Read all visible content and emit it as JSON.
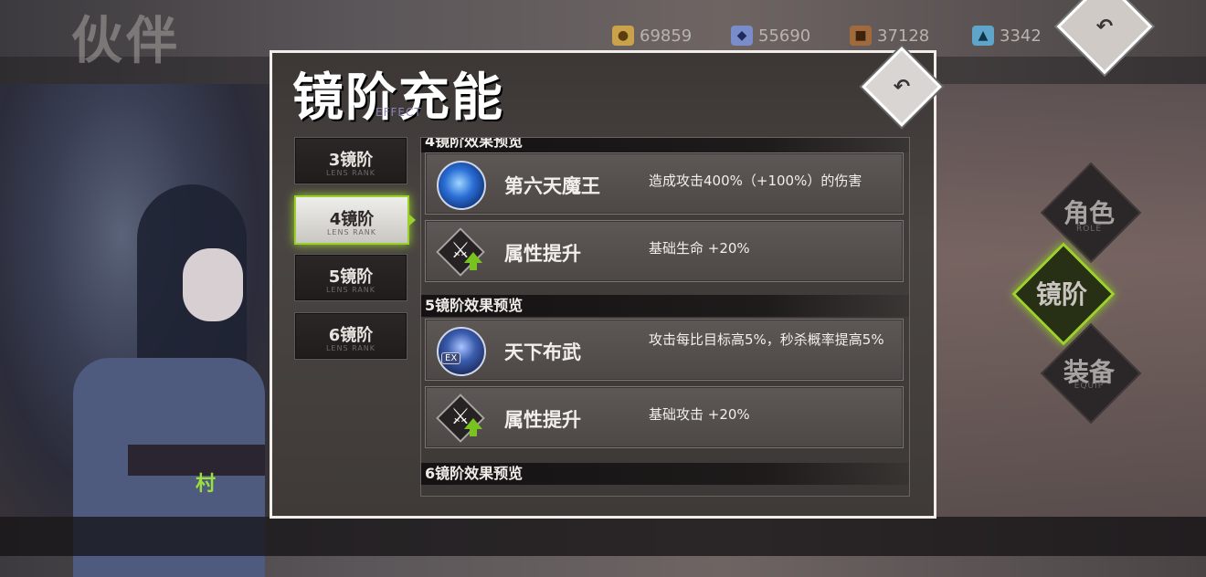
{
  "background": {
    "page_title": "伙伴",
    "character_name": "村"
  },
  "currencies": [
    {
      "icon": "gold-coin-icon",
      "value": "69859",
      "color": "#c9a24a"
    },
    {
      "icon": "crystal-icon",
      "value": "55690",
      "color": "#7a8cc9"
    },
    {
      "icon": "chest-icon",
      "value": "37128",
      "color": "#a06a3c"
    },
    {
      "icon": "ticket-icon",
      "value": "3342",
      "color": "#5fa4c9"
    }
  ],
  "side_tabs": [
    {
      "label": "角色",
      "sub": "ROLE",
      "active": false
    },
    {
      "label": "镜阶",
      "sub": "",
      "active": true
    },
    {
      "label": "装备",
      "sub": "EQUIP",
      "active": false
    }
  ],
  "dialog": {
    "title": "镜阶充能",
    "subtitle": "EFFECT",
    "rank_tabs": [
      {
        "label": "3镜阶",
        "sub": "LENS RANK",
        "active": false
      },
      {
        "label": "4镜阶",
        "sub": "LENS RANK",
        "active": true
      },
      {
        "label": "5镜阶",
        "sub": "LENS RANK",
        "active": false
      },
      {
        "label": "6镜阶",
        "sub": "LENS RANK",
        "active": false
      }
    ],
    "sections": [
      {
        "heading": "4镜阶效果预览",
        "rows": [
          {
            "name": "第六天魔王",
            "desc": "造成攻击400%（+100%）的伤害",
            "icon": "demon-king-skill-icon"
          },
          {
            "name": "属性提升",
            "desc": "基础生命 +20%",
            "icon": "stat-up-icon"
          }
        ]
      },
      {
        "heading": "5镜阶效果预览",
        "rows": [
          {
            "name": "天下布武",
            "desc": "攻击每比目标高5%，秒杀概率提高5%",
            "icon": "ex-skill-icon",
            "badge": "EX"
          },
          {
            "name": "属性提升",
            "desc": "基础攻击 +20%",
            "icon": "stat-up-icon"
          }
        ]
      },
      {
        "heading": "6镜阶效果预览",
        "rows": []
      }
    ]
  },
  "colors": {
    "accent_green": "#9bd02c",
    "dialog_border": "#f1eeea"
  }
}
